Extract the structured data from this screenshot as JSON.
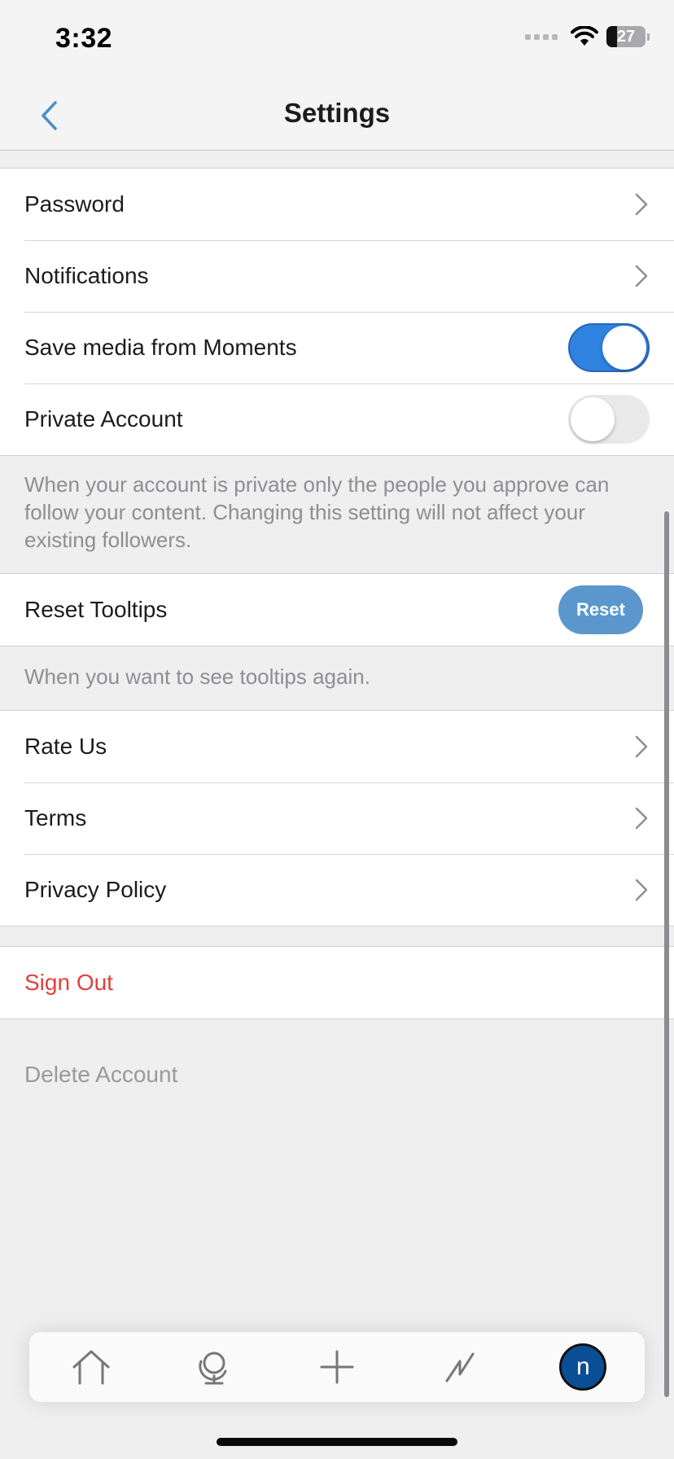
{
  "status": {
    "time": "3:32",
    "battery": "27"
  },
  "nav": {
    "title": "Settings",
    "back_icon": "chevron-left-icon"
  },
  "account_group": {
    "password": "Password",
    "notifications": "Notifications",
    "save_media": "Save media from Moments",
    "save_media_on": true,
    "private_account": "Private Account",
    "private_account_on": false
  },
  "private_note": "When your account is private only the people you approve can follow your content. Changing this setting will not affect your existing followers.",
  "tooltips": {
    "label": "Reset Tooltips",
    "button": "Reset",
    "note": "When you want to see tooltips again."
  },
  "info_group": {
    "rate_us": "Rate Us",
    "terms": "Terms",
    "privacy_policy": "Privacy Policy"
  },
  "sign_out": "Sign Out",
  "delete_account": "Delete Account",
  "tab_bar": {
    "tabs": [
      "home-icon",
      "globe-icon",
      "plus-icon",
      "activity-icon",
      "profile-avatar"
    ],
    "avatar_initial": "n"
  },
  "colors": {
    "accent": "#2f82df",
    "reset_button": "#5b97cc",
    "sign_out": "#e0423f",
    "avatar": "#0a4f96"
  }
}
